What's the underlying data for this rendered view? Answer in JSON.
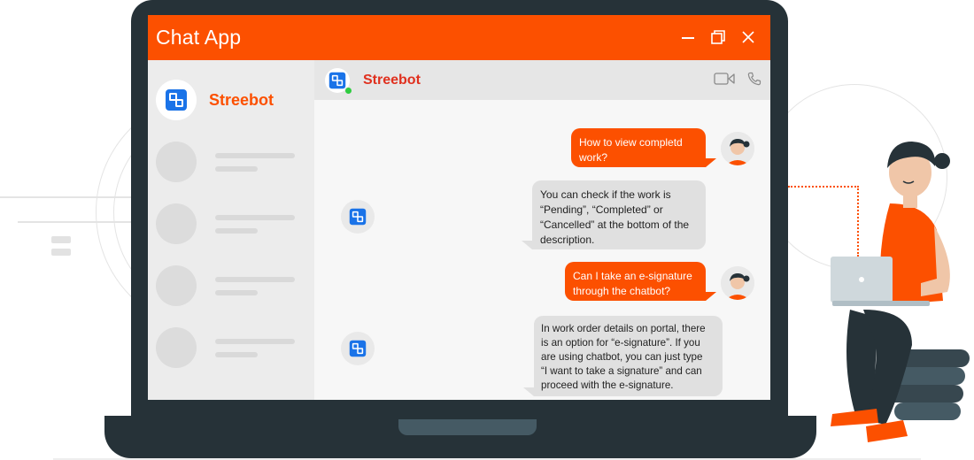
{
  "window": {
    "title": "Chat App"
  },
  "controls": {
    "minimize": "minimize",
    "maximize": "maximize",
    "close": "close"
  },
  "sidebar": {
    "active_contact": {
      "name": "Streebot"
    }
  },
  "chat": {
    "header_name": "Streebot",
    "messages": [
      {
        "sender": "user",
        "lines": [
          "How to view completd",
          "work?"
        ]
      },
      {
        "sender": "bot",
        "lines": [
          "You can check if the work is",
          "“Pending”, “Completed” or",
          "“Cancelled” at the bottom of the",
          "description."
        ]
      },
      {
        "sender": "user",
        "lines": [
          "Can I take an e-signature",
          "through the chatbot?"
        ]
      },
      {
        "sender": "bot",
        "lines": [
          "In work order details on portal, there",
          "is an option for “e-signature”. If you",
          "are using chatbot, you can just type",
          "“I want to take a signature” and can",
          "proceed with the e-signature."
        ]
      }
    ]
  },
  "icons": {
    "brand": "streebot-logo-icon",
    "video": "video-call-icon",
    "phone": "phone-icon"
  },
  "colors": {
    "accent": "#fc5000",
    "header_name": "#e0301e",
    "frame": "#263238",
    "online": "#2ecc40",
    "logo": "#1a73e8"
  }
}
